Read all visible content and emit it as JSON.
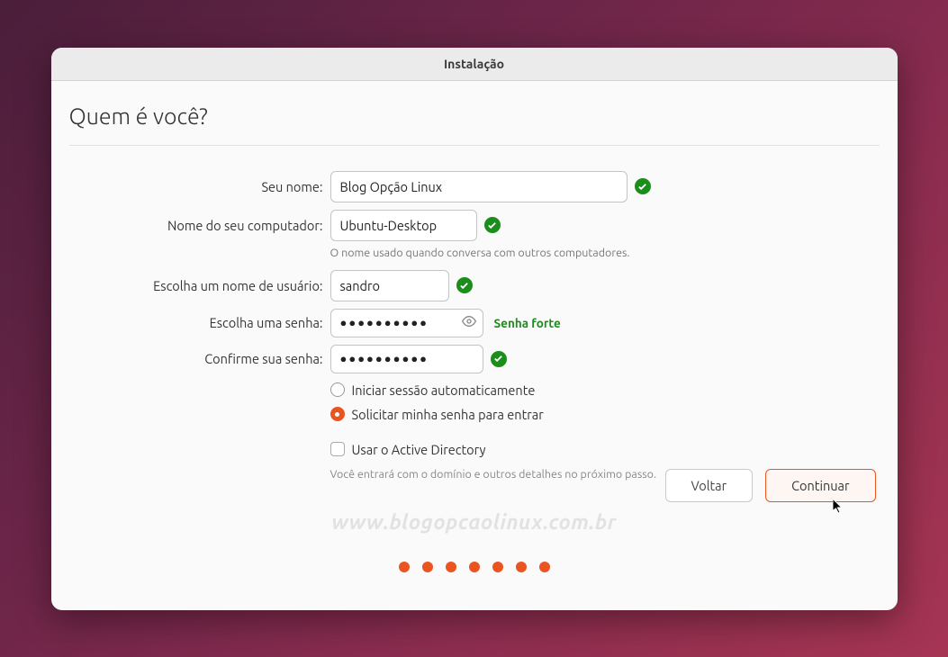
{
  "window_title": "Instalação",
  "heading": "Quem é você?",
  "labels": {
    "name": "Seu nome:",
    "computer": "Nome do seu computador:",
    "username": "Escolha um nome de usuário:",
    "password": "Escolha uma senha:",
    "confirm": "Confirme sua senha:"
  },
  "values": {
    "name": "Blog Opção Linux",
    "computer": "Ubuntu-Desktop",
    "username": "sandro",
    "password_mask": "●●●●●●●●●●",
    "confirm_mask": "●●●●●●●●●●"
  },
  "helpers": {
    "computer": "O nome usado quando conversa com outros computadores.",
    "ad": "Você entrará com o domínio e outros detalhes no próximo passo."
  },
  "strength_text": "Senha forte",
  "login_options": {
    "auto": "Iniciar sessão automaticamente",
    "require": "Solicitar minha senha para entrar",
    "selected": "require"
  },
  "ad_checkbox": {
    "label": "Usar o Active Directory",
    "checked": false
  },
  "buttons": {
    "back": "Voltar",
    "continue": "Continuar"
  },
  "watermark": "www.blogopcaolinux.com.br",
  "progress_dots": 7
}
